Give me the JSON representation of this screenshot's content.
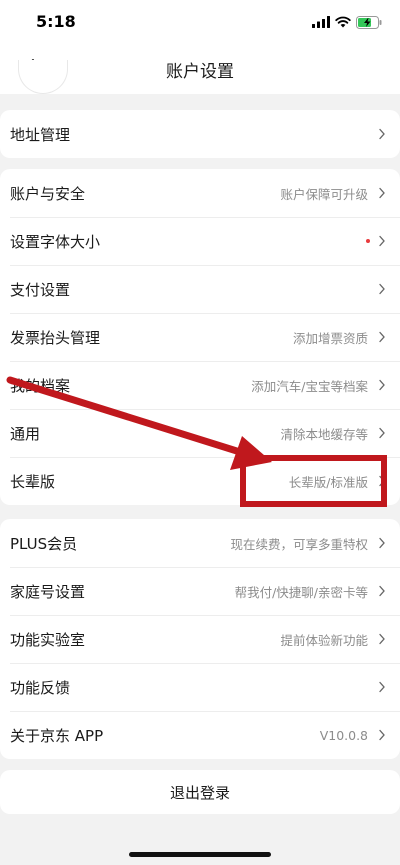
{
  "status_bar": {
    "time": "5:18"
  },
  "nav": {
    "title": "账户设置"
  },
  "groups": [
    {
      "items": [
        {
          "label": "地址管理",
          "value": ""
        }
      ]
    },
    {
      "items": [
        {
          "label": "账户与安全",
          "value": "账户保障可升级"
        },
        {
          "label": "设置字体大小",
          "value": "",
          "dot": true
        },
        {
          "label": "支付设置",
          "value": ""
        },
        {
          "label": "发票抬头管理",
          "value": "添加增票资质"
        },
        {
          "label": "我的档案",
          "value": "添加汽车/宝宝等档案"
        },
        {
          "label": "通用",
          "value": "清除本地缓存等"
        },
        {
          "label": "长辈版",
          "value": "长辈版/标准版"
        }
      ]
    },
    {
      "items": [
        {
          "label": "PLUS会员",
          "value": "现在续费，可享多重特权"
        },
        {
          "label": "家庭号设置",
          "value": "帮我付/快捷聊/亲密卡等"
        },
        {
          "label": "功能实验室",
          "value": "提前体验新功能"
        },
        {
          "label": "功能反馈",
          "value": ""
        },
        {
          "label": "关于京东 APP",
          "value": "V10.0.8"
        }
      ]
    }
  ],
  "logout": {
    "label": "退出登录"
  },
  "colors": {
    "annotation": "#c0181d",
    "red_dot": "#e93b3d"
  }
}
